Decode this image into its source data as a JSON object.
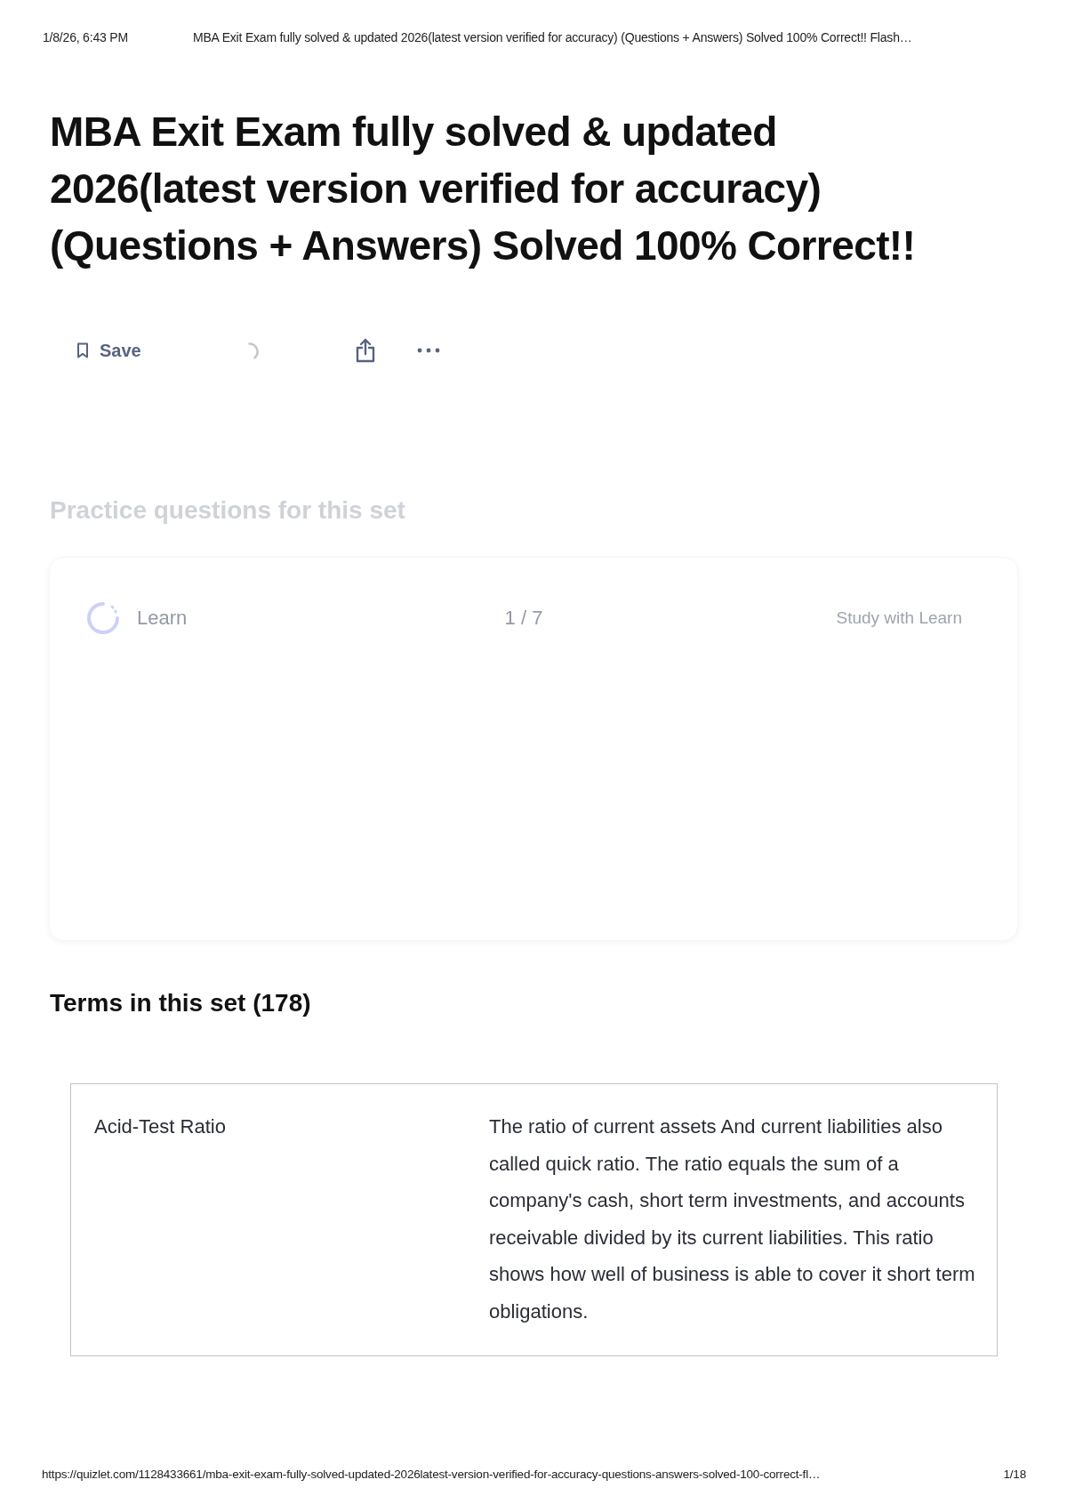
{
  "print_header": {
    "date": "1/8/26, 6:43 PM",
    "title": "MBA Exit Exam fully solved & updated 2026(latest version verified for accuracy) (Questions + Answers) Solved 100% Correct!! Flash…"
  },
  "heading": "MBA Exit Exam fully solved & updated 2026(latest version verified for accuracy) (Questions + Answers) Solved 100% Correct!!",
  "toolbar": {
    "save_label": "Save"
  },
  "practice": {
    "heading": "Practice questions for this set",
    "learn_label": "Learn",
    "progress": "1 / 7",
    "action": "Study with Learn"
  },
  "terms": {
    "heading": "Terms in this set (178)",
    "cards": [
      {
        "term": "Acid-Test Ratio",
        "definition": "The ratio of current assets And current liabilities also called quick ratio. The ratio equals the sum of a company's cash, short term investments, and accounts receivable divided by its current liabilities. This ratio shows how well of business is able to cover it short term obligations."
      }
    ]
  },
  "print_footer": {
    "url": "https://quizlet.com/1128433661/mba-exit-exam-fully-solved-updated-2026latest-version-verified-for-accuracy-questions-answers-solved-100-correct-fl…",
    "page": "1/18"
  }
}
